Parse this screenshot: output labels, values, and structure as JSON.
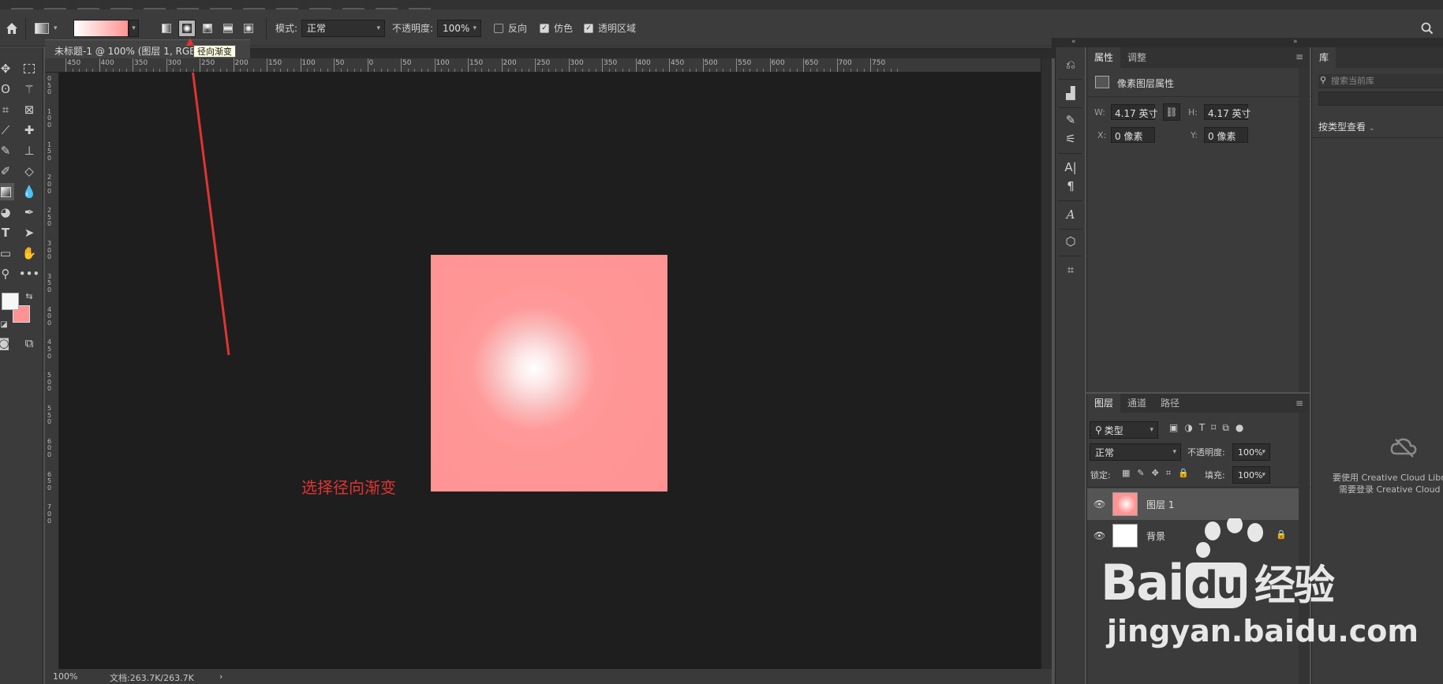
{
  "options_bar": {
    "mode_label": "模式:",
    "mode_value": "正常",
    "opacity_label": "不透明度:",
    "opacity_value": "100%",
    "reverse_label": "反向",
    "dither_label": "仿色",
    "transparency_label": "透明区域",
    "tooltip": "径向渐变",
    "gradient_colors": [
      "#ffffff",
      "#ff9393"
    ]
  },
  "document": {
    "tab_title": "未标题-1 @ 100% (图层 1, RGB",
    "ruler_top_labels": [
      "450",
      "400",
      "350",
      "300",
      "250",
      "200",
      "150",
      "100",
      "50",
      "0",
      "50",
      "100",
      "150",
      "200",
      "250",
      "300",
      "350",
      "400",
      "450",
      "500",
      "550",
      "600",
      "650",
      "700",
      "750"
    ],
    "ruler_left_labels": [
      "0",
      "5",
      "0",
      "1",
      "0",
      "0",
      "1",
      "5",
      "0",
      "2",
      "0",
      "0",
      "2",
      "5",
      "0",
      "3",
      "0",
      "0",
      "3",
      "5",
      "0",
      "4",
      "0",
      "0",
      "4",
      "5",
      "0",
      "5",
      "0",
      "0",
      "5",
      "5",
      "0",
      "6",
      "0",
      "0",
      "6",
      "5",
      "0",
      "7",
      "0",
      "0"
    ],
    "annotation": "选择径向渐变",
    "canvas_color": "#ff9393",
    "accent_color": "#e13333"
  },
  "status_bar": {
    "zoom": "100%",
    "doc_info": "文档:263.7K/263.7K"
  },
  "properties_panel": {
    "tabs": [
      "属性",
      "调整"
    ],
    "section_title": "像素图层属性",
    "w_label": "W:",
    "w_value": "4.17 英寸",
    "h_label": "H:",
    "h_value": "4.17 英寸",
    "x_label": "X:",
    "x_value": "0 像素",
    "y_label": "Y:",
    "y_value": "0 像素"
  },
  "layers_panel": {
    "tabs": [
      "图层",
      "通道",
      "路径"
    ],
    "filter_label": "类型",
    "blend_mode": "正常",
    "opacity_label": "不透明度:",
    "opacity_value": "100%",
    "lock_label": "锁定:",
    "fill_label": "填充:",
    "fill_value": "100%",
    "layers": [
      {
        "name": "图层 1",
        "selected": true
      },
      {
        "name": "背景",
        "selected": false,
        "locked": true
      }
    ]
  },
  "library_panel": {
    "tab": "库",
    "search_placeholder": "搜索当前库",
    "view_by": "按类型查看",
    "cloud_message_line1": "要使用 Creative Cloud Libr",
    "cloud_message_line2": "需要登录 Creative Cloud"
  },
  "watermark": {
    "logo_text_bai": "Bai",
    "logo_text_du": "du",
    "logo_text_cn": "经验",
    "url": "jingyan.baidu.com"
  }
}
